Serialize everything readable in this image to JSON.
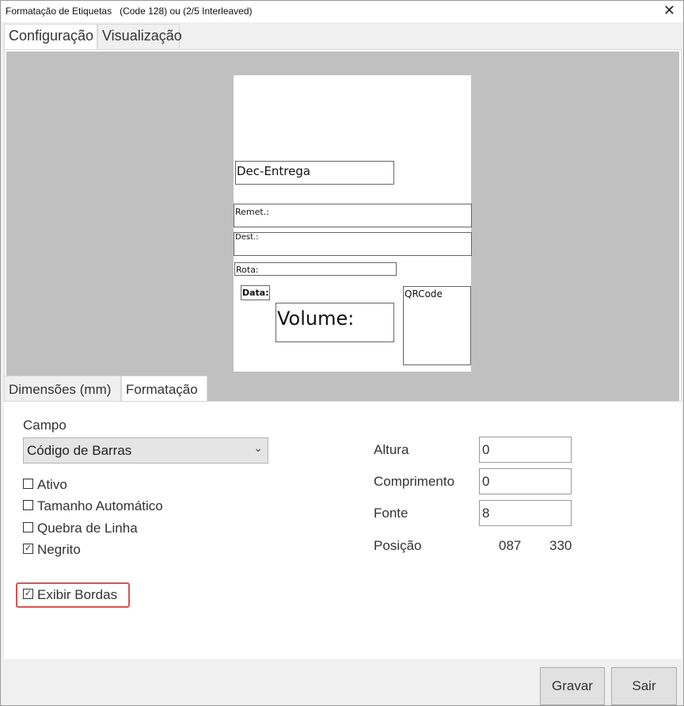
{
  "window": {
    "title": "Formatação de Etiquetas   (Code 128) ou (2/5 Interleaved)",
    "close_label": "✕"
  },
  "tabs": [
    {
      "label": "Configuração",
      "active": true
    },
    {
      "label": "Visualização",
      "active": false
    }
  ],
  "preview": {
    "fields": {
      "dec_entrega": "Dec-Entrega",
      "remet": "Remet.:",
      "dest": "Dest.:",
      "rota": "Rota:",
      "data": "Data:",
      "volume": "Volume:",
      "qrcode": "QRCode"
    }
  },
  "inner_tabs": [
    {
      "label": "Dimensões (mm)",
      "active": false
    },
    {
      "label": "Formatação",
      "active": true
    }
  ],
  "form": {
    "campo_label": "Campo",
    "campo_value": "Código de Barras",
    "caret_icon": "chevron-down-icon",
    "checkboxes": [
      {
        "label": "Ativo",
        "checked": false
      },
      {
        "label": "Tamanho Automático",
        "checked": false
      },
      {
        "label": "Quebra de Linha",
        "checked": false
      },
      {
        "label": "Negrito",
        "checked": true
      }
    ],
    "exibir_bordas": {
      "label": "Exibir Bordas",
      "checked": true
    },
    "altura_label": "Altura",
    "altura_value": "0",
    "comprimento_label": "Comprimento",
    "comprimento_value": "0",
    "fonte_label": "Fonte",
    "fonte_value": "8",
    "posicao_label": "Posição",
    "posicao_x": "087",
    "posicao_y": "330"
  },
  "buttons": {
    "gravar": "Gravar",
    "sair": "Sair"
  },
  "colors": {
    "highlight": "#d9534f",
    "preview_bg": "#c0c0c0"
  }
}
